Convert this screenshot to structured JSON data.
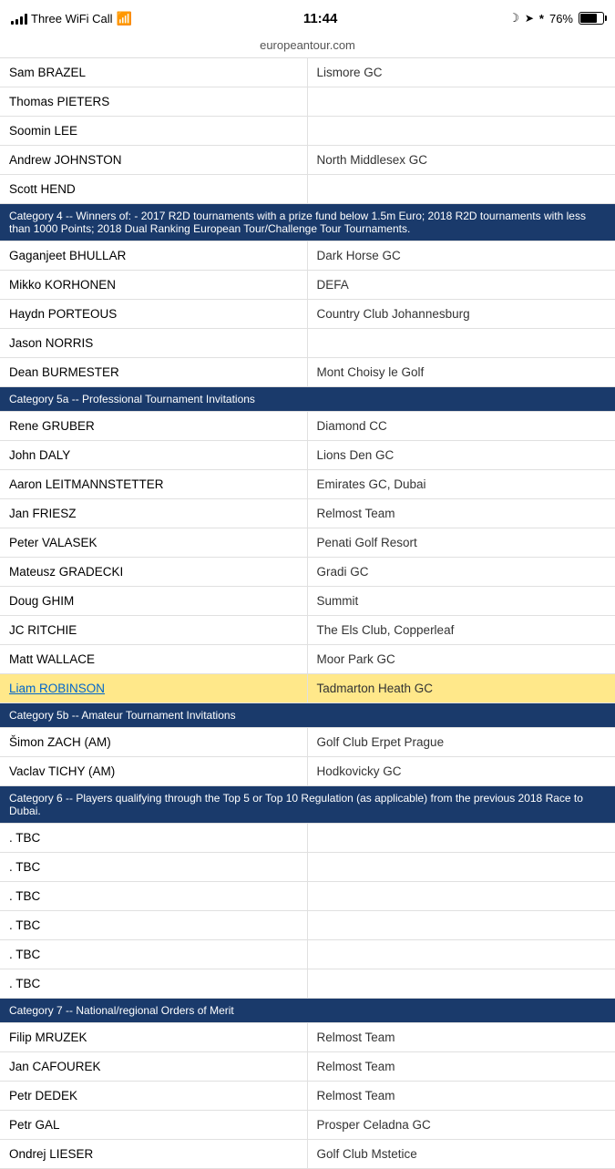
{
  "statusBar": {
    "carrier": "Three WiFi Call",
    "time": "11:44",
    "battery": "76%",
    "url": "europeantour.com"
  },
  "table": {
    "rows": [
      {
        "type": "data",
        "name": "Sam BRAZEL",
        "club": "Lismore GC",
        "highlighted": false
      },
      {
        "type": "data",
        "name": "Thomas PIETERS",
        "club": "",
        "highlighted": false
      },
      {
        "type": "data",
        "name": "Soomin LEE",
        "club": "",
        "highlighted": false
      },
      {
        "type": "data",
        "name": "Andrew JOHNSTON",
        "club": "North Middlesex GC",
        "highlighted": false
      },
      {
        "type": "data",
        "name": "Scott HEND",
        "club": "",
        "highlighted": false
      },
      {
        "type": "category",
        "label": "Category 4 -- Winners of: - 2017 R2D tournaments with a prize fund below 1.5m Euro; 2018 R2D tournaments with less than 1000 Points; 2018 Dual Ranking European Tour/Challenge Tour Tournaments."
      },
      {
        "type": "data",
        "name": "Gaganjeet BHULLAR",
        "club": "Dark Horse GC",
        "highlighted": false
      },
      {
        "type": "data",
        "name": "Mikko KORHONEN",
        "club": "DEFA",
        "highlighted": false
      },
      {
        "type": "data",
        "name": "Haydn PORTEOUS",
        "club": "Country Club Johannesburg",
        "highlighted": false
      },
      {
        "type": "data",
        "name": "Jason NORRIS",
        "club": "",
        "highlighted": false
      },
      {
        "type": "data",
        "name": "Dean BURMESTER",
        "club": "Mont Choisy le Golf",
        "highlighted": false
      },
      {
        "type": "category",
        "label": "Category 5a -- Professional Tournament Invitations"
      },
      {
        "type": "data",
        "name": "Rene GRUBER",
        "club": "Diamond CC",
        "highlighted": false
      },
      {
        "type": "data",
        "name": "John DALY",
        "club": "Lions Den GC",
        "highlighted": false
      },
      {
        "type": "data",
        "name": "Aaron LEITMANNSTETTER",
        "club": "Emirates GC, Dubai",
        "highlighted": false
      },
      {
        "type": "data",
        "name": "Jan FRIESZ",
        "club": "Relmost Team",
        "highlighted": false
      },
      {
        "type": "data",
        "name": "Peter VALASEK",
        "club": "Penati Golf Resort",
        "highlighted": false
      },
      {
        "type": "data",
        "name": "Mateusz GRADECKI",
        "club": "Gradi GC",
        "highlighted": false
      },
      {
        "type": "data",
        "name": "Doug GHIM",
        "club": "Summit",
        "highlighted": false
      },
      {
        "type": "data",
        "name": "JC RITCHIE",
        "club": "The Els Club, Copperleaf",
        "highlighted": false
      },
      {
        "type": "data",
        "name": "Matt WALLACE",
        "club": "Moor Park GC",
        "highlighted": false
      },
      {
        "type": "data",
        "name": "Liam ROBINSON",
        "club": "Tadmarton Heath GC",
        "highlighted": true
      },
      {
        "type": "category",
        "label": "Category 5b -- Amateur Tournament Invitations"
      },
      {
        "type": "data",
        "name": "Šimon ZACH (AM)",
        "club": "Golf Club Erpet Prague",
        "highlighted": false
      },
      {
        "type": "data",
        "name": "Vaclav TICHY (AM)",
        "club": "Hodkovicky GC",
        "highlighted": false
      },
      {
        "type": "category",
        "label": "Category 6 -- Players qualifying through the Top 5 or Top 10 Regulation (as applicable) from the previous 2018 Race to Dubai."
      },
      {
        "type": "data",
        "name": ". TBC",
        "club": "",
        "highlighted": false
      },
      {
        "type": "data",
        "name": ". TBC",
        "club": "",
        "highlighted": false
      },
      {
        "type": "data",
        "name": ". TBC",
        "club": "",
        "highlighted": false
      },
      {
        "type": "data",
        "name": ". TBC",
        "club": "",
        "highlighted": false
      },
      {
        "type": "data",
        "name": ". TBC",
        "club": "",
        "highlighted": false
      },
      {
        "type": "data",
        "name": ". TBC",
        "club": "",
        "highlighted": false
      },
      {
        "type": "category",
        "label": "Category 7 -- National/regional Orders of Merit"
      },
      {
        "type": "data",
        "name": "Filip MRUZEK",
        "club": "Relmost Team",
        "highlighted": false
      },
      {
        "type": "data",
        "name": "Jan CAFOUREK",
        "club": "Relmost Team",
        "highlighted": false
      },
      {
        "type": "data",
        "name": "Petr DEDEK",
        "club": "Relmost Team",
        "highlighted": false
      },
      {
        "type": "data",
        "name": "Petr GAL",
        "club": "Prosper Celadna GC",
        "highlighted": false
      },
      {
        "type": "data",
        "name": "Ondrej LIESER",
        "club": "Golf Club Mstetice",
        "highlighted": false
      }
    ]
  }
}
